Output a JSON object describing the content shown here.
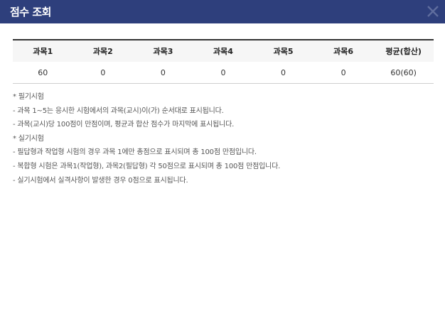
{
  "header": {
    "title": "점수 조회",
    "close_icon": "close-icon",
    "background": "#2e3f7c"
  },
  "table": {
    "columns": [
      "과목1",
      "과목2",
      "과목3",
      "과목4",
      "과목5",
      "과목6",
      "평균(합산)"
    ],
    "rows": [
      [
        "60",
        "0",
        "0",
        "0",
        "0",
        "0",
        "60(60)"
      ]
    ]
  },
  "notes": [
    "* 필기시험",
    "- 과목 1~5는 응시한 시험에서의 과목(교시)이(가) 순서대로 표시됩니다.",
    "- 과목(교시)당 100점이 만점이며, 평균과 합산 점수가 마지막에 표시됩니다.",
    "* 실기시험",
    "- 필답형과 작업형 시험의 경우 과목 1에만 총점으로 표시되며 총 100점 만점입니다.",
    "- 복합형 시험은 과목1(작업형), 과목2(필답형) 각 50점으로 표시되며 총 100점 만점입니다.",
    "- 실기시험에서 실격사항이 발생한 경우 0점으로 표시됩니다."
  ]
}
